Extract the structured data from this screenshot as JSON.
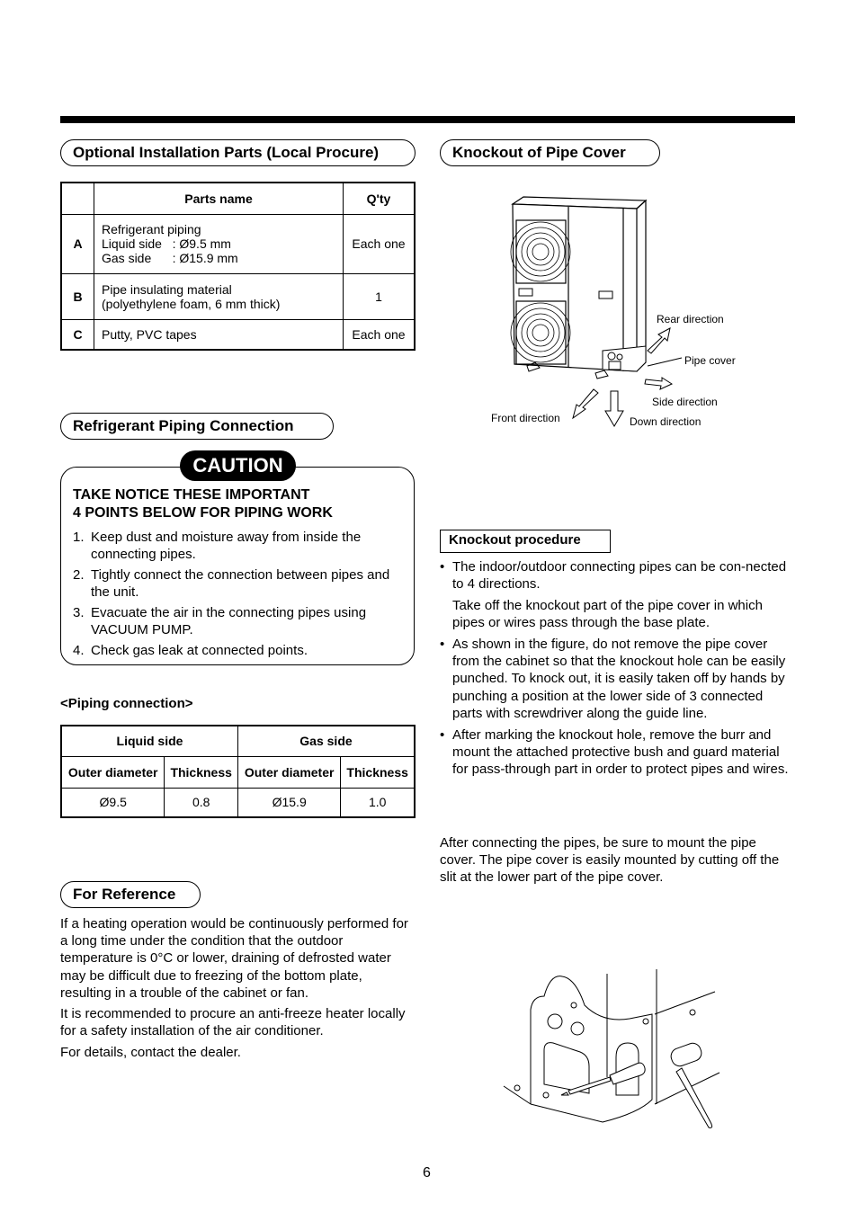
{
  "page_number": "6",
  "sections": {
    "optional_parts": {
      "title": "Optional Installation Parts (Local Procure)",
      "table": {
        "headers": [
          "",
          "Parts name",
          "Q'ty"
        ],
        "rows": [
          {
            "label": "A",
            "name_lines": [
              "Refrigerant piping",
              "Liquid side   : Ø9.5 mm",
              "Gas side      : Ø15.9 mm"
            ],
            "qty": "Each one"
          },
          {
            "label": "B",
            "name_lines": [
              "Pipe insulating material",
              "(polyethylene foam, 6 mm thick)"
            ],
            "qty": "1"
          },
          {
            "label": "C",
            "name_lines": [
              "Putty, PVC tapes"
            ],
            "qty": "Each one"
          }
        ]
      }
    },
    "refrigerant_piping": {
      "title": "Refrigerant Piping Connection",
      "caution": {
        "badge": "CAUTION",
        "heading_lines": [
          "TAKE NOTICE THESE IMPORTANT",
          "4 POINTS BELOW FOR PIPING WORK"
        ],
        "items": [
          {
            "num": "1.",
            "text": "Keep dust and moisture away from inside the connecting pipes."
          },
          {
            "num": "2.",
            "text": "Tightly connect the connection between pipes and the unit."
          },
          {
            "num": "3.",
            "text": "Evacuate the air in the connecting pipes using VACUUM PUMP."
          },
          {
            "num": "4.",
            "text": "Check gas leak at connected points."
          }
        ]
      },
      "piping_connection": {
        "title": "<Piping connection>",
        "group_headers": [
          "Liquid side",
          "Gas side"
        ],
        "sub_headers": [
          "Outer diameter",
          "Thickness",
          "Outer diameter",
          "Thickness"
        ],
        "values": [
          "Ø9.5",
          "0.8",
          "Ø15.9",
          "1.0"
        ]
      }
    },
    "for_reference": {
      "title": "For Reference",
      "paragraphs": [
        "If a heating operation would be continuously performed for a long time under the condition that the outdoor temperature is 0°C or lower, draining of defrosted water may be difficult due to freezing of the bottom plate, resulting in a trouble of the cabinet or fan.",
        "It is recommended to procure an anti-freeze heater locally for a safety installation of the air conditioner.",
        "For details, contact the dealer."
      ]
    },
    "knockout": {
      "title": "Knockout of Pipe Cover",
      "figure_labels": {
        "rear": "Rear direction",
        "pipe_cover": "Pipe cover",
        "side": "Side direction",
        "front": "Front direction",
        "down": "Down direction"
      },
      "procedure": {
        "title": "Knockout procedure",
        "bullets": [
          {
            "paras": [
              "The indoor/outdoor connecting pipes can be con-nected to 4 directions.",
              "Take off the knockout part of the pipe cover in which pipes or wires pass through the base plate."
            ]
          },
          {
            "paras": [
              "As shown in the figure, do not remove the pipe cover from the cabinet so that the knockout hole can be easily punched. To knock out, it is easily taken off by hands by punching a position at the lower side of 3 connected parts with screwdriver along the guide line."
            ]
          },
          {
            "paras": [
              "After marking the knockout hole, remove the burr and mount the attached protective bush and guard material for pass-through part in order to protect pipes and wires."
            ]
          }
        ],
        "bullet_char": "•"
      },
      "after_note": "After connecting the pipes, be sure to mount the pipe cover. The pipe cover is easily mounted by cutting off the slit at the lower part of the pipe cover."
    }
  }
}
